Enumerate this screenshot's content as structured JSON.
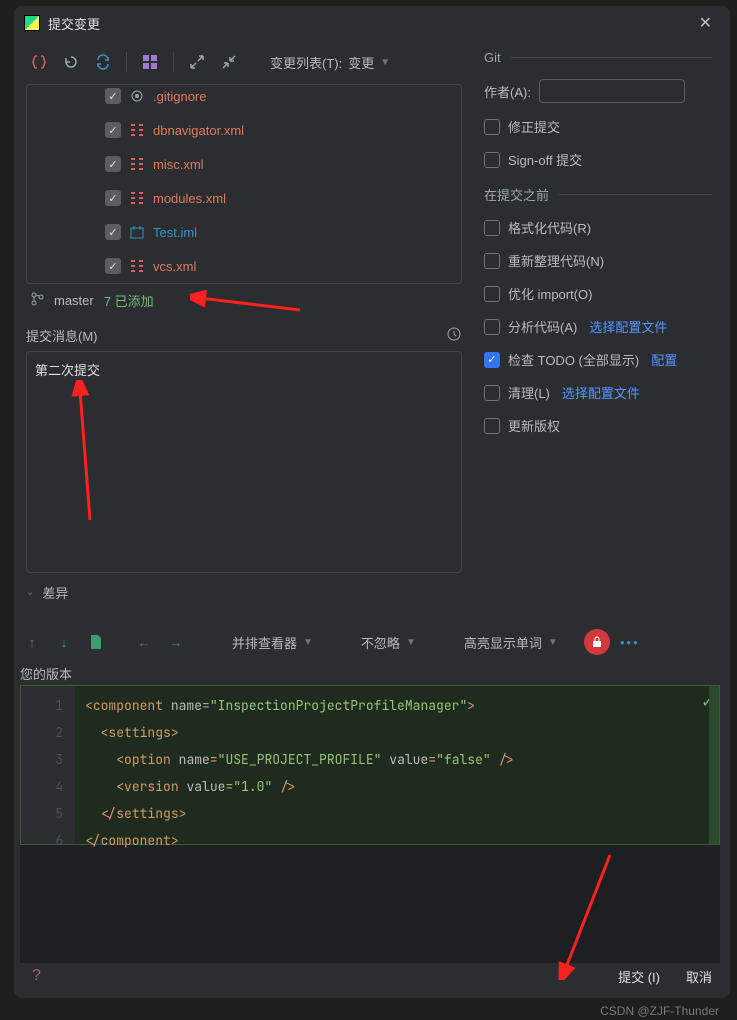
{
  "title": "提交变更",
  "toolbar": {
    "changes_label": "变更列表(T):",
    "changes_value": "变更"
  },
  "files": [
    {
      "name": ".gitignore",
      "icon": "gear",
      "color": "file-name"
    },
    {
      "name": "dbnavigator.xml",
      "icon": "xml",
      "color": "file-name"
    },
    {
      "name": "misc.xml",
      "icon": "xml",
      "color": "file-name"
    },
    {
      "name": "modules.xml",
      "icon": "xml",
      "color": "file-name"
    },
    {
      "name": "Test.iml",
      "icon": "iml",
      "color": "file-name blue"
    },
    {
      "name": "vcs.xml",
      "icon": "xml",
      "color": "file-name"
    }
  ],
  "branch": {
    "name": "master",
    "status": "7 已添加"
  },
  "commit_msg_label": "提交消息(M)",
  "commit_msg": "第二次提交",
  "diff_label": "差异",
  "git_section": "Git",
  "author_label": "作者(A):",
  "opts": {
    "amend": "修正提交",
    "signoff": "Sign-off 提交"
  },
  "before_section": "在提交之前",
  "before": {
    "reformat": "格式化代码(R)",
    "rearrange": "重新整理代码(N)",
    "optimize": "优化 import(O)",
    "analyze": "分析代码(A)",
    "analyze_link": "选择配置文件",
    "todo": "检查 TODO (全部显示)",
    "todo_link": "配置",
    "cleanup": "清理(L)",
    "cleanup_link": "选择配置文件",
    "copyright": "更新版权"
  },
  "diff_tb": {
    "viewer": "并排查看器",
    "ignore": "不忽略",
    "highlight": "高亮显示单词"
  },
  "version_label": "您的版本",
  "code": {
    "l1a": "component",
    "l1b": "name",
    "l1c": "\"InspectionProjectProfileManager\"",
    "l2": "settings",
    "l3a": "option",
    "l3b": "name",
    "l3c": "\"USE_PROJECT_PROFILE\"",
    "l3d": "value",
    "l3e": "\"false\"",
    "l4a": "version",
    "l4b": "value",
    "l4c": "\"1.0\"",
    "l5": "settings",
    "l6": "component"
  },
  "buttons": {
    "commit": "提交 (I)",
    "cancel": "取消"
  },
  "watermark": "CSDN @ZJF-Thunder"
}
